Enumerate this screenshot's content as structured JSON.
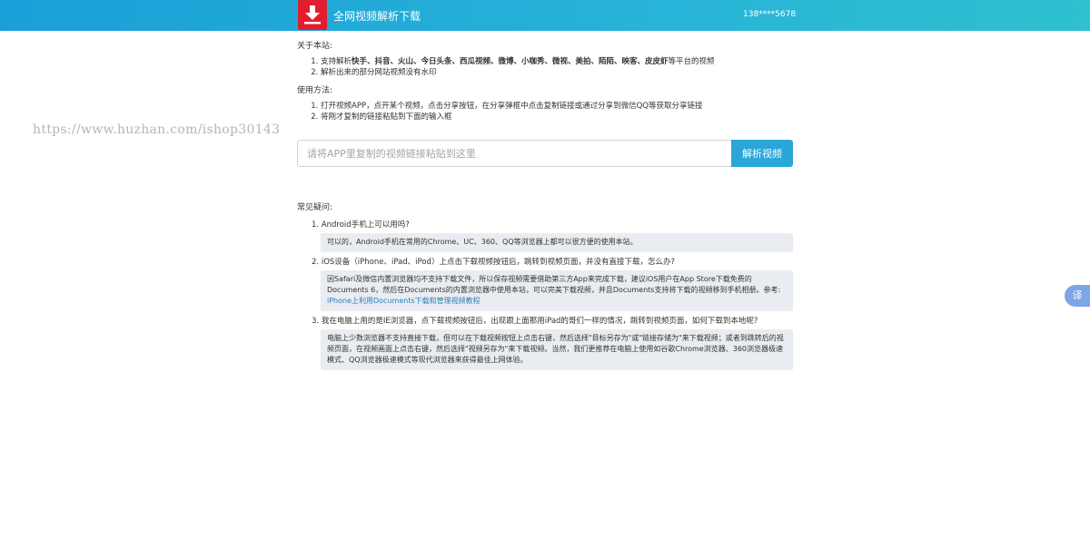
{
  "header": {
    "logo_icon": "download-icon",
    "title": "全网视频解析下载",
    "user_phone": "138****5678",
    "gradient_start": "#1a9fd8",
    "gradient_end": "#2fc1cf",
    "logo_color": "#e11d2f"
  },
  "about": {
    "title": "关于本站:",
    "items": [
      {
        "prefix": "支持解析",
        "platforms": "快手、抖音、火山、今日头条、西瓜视频、微博、小咖秀、微视、美拍、陌陌、映客、皮皮虾",
        "suffix": "等平台的视频"
      },
      {
        "text": "解析出来的部分网站视频没有水印"
      }
    ]
  },
  "usage": {
    "title": "使用方法:",
    "items": [
      "打开视频APP，点开某个视频，点击分享按钮，在分享弹框中点击复制链接或通过分享到微信QQ等获取分享链接",
      "将刚才复制的链接粘贴到下面的输入框"
    ]
  },
  "watermark": "https://www.huzhan.com/ishop30143",
  "search": {
    "placeholder": "请将APP里复制的视频链接粘贴到这里",
    "value": "",
    "button_label": "解析视频",
    "button_color": "#2aa6d9"
  },
  "faq": {
    "title": "常见疑问:",
    "items": [
      {
        "number": "1.",
        "question": "Android手机上可以用吗?",
        "answer": "可以的，Android手机在常用的Chrome、UC、360、QQ等浏览器上都可以很方便的使用本站。"
      },
      {
        "number": "2.",
        "question": "iOS设备（iPhone、iPad、iPod）上点击下载视频按钮后，跳转到视频页面，并没有直接下载，怎么办?",
        "answer": "因Safari及微信内置浏览器均不支持下载文件，所以保存视频需要借助第三方App来完成下载，建议iOS用户在App Store下载免费的Documents 6，然后在Documents的内置浏览器中使用本站，可以完美下载视频，并且Documents支持将下载的视频移到手机相册。参考:",
        "link": "iPhone上利用Documents下载和管理视频教程"
      },
      {
        "number": "3.",
        "question": "我在电脑上用的是IE浏览器，点下载视频按钮后，出现跟上面那用iPad的哥们一样的情况，跳转到视频页面，如何下载到本地呢?",
        "answer": "电脑上少数浏览器不支持直接下载，但可以在下载视频按钮上点击右键，然后选择\"目标另存为\"或\"链接存储为\"来下载视频；或者到跳转后的视频页面，在视频画面上点击右键，然后选择\"视频另存为\"来下载视频。当然，我们更推荐在电脑上使用如谷歌Chrome浏览器、360浏览器极速模式、QQ浏览器极速模式等现代浏览器来获得最佳上网体验。"
      }
    ]
  },
  "translate_tab": {
    "label": "译",
    "icon": "translate-icon"
  }
}
